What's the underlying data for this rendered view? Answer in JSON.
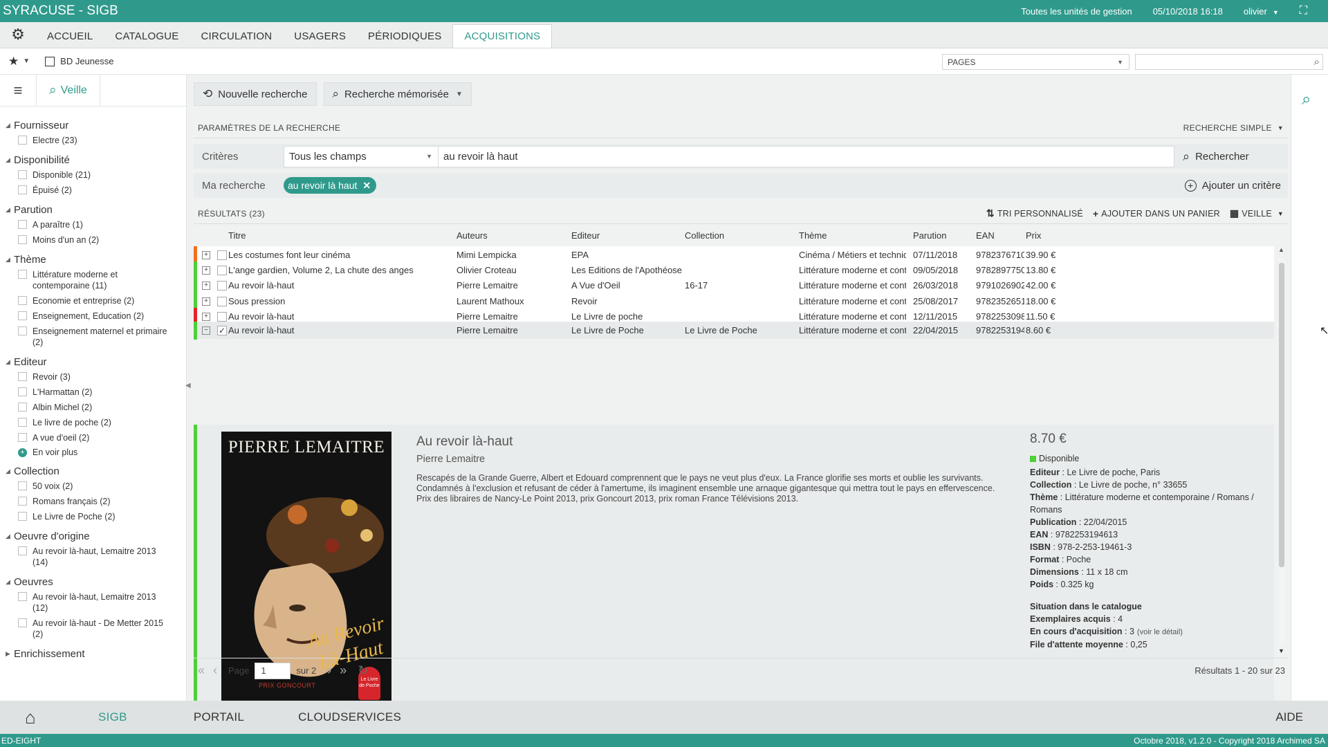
{
  "window": {
    "title": "SYRACUSE - SIGB",
    "units": "Toutes les unités de gestion",
    "datetime": "05/10/2018 16:18",
    "user": "olivier"
  },
  "menu": {
    "tabs": [
      "ACCUEIL",
      "CATALOGUE",
      "CIRCULATION",
      "USAGERS",
      "PÉRIODIQUES",
      "ACQUISITIONS"
    ],
    "active": "ACQUISITIONS"
  },
  "toolbar": {
    "bookmark": "BD Jeunesse",
    "pages_select": "PAGES",
    "search_value": ""
  },
  "sidebar": {
    "tab_label": "Veille",
    "facets": [
      {
        "title": "Fournisseur",
        "items": [
          "Electre (23)"
        ]
      },
      {
        "title": "Disponibilité",
        "items": [
          "Disponible (21)",
          "Épuisé (2)"
        ]
      },
      {
        "title": "Parution",
        "items": [
          "A paraître (1)",
          "Moins d'un an (2)"
        ]
      },
      {
        "title": "Thème",
        "items": [
          "Littérature moderne et contemporaine (11)",
          "Economie et entreprise (2)",
          "Enseignement, Education (2)",
          "Enseignement maternel et primaire (2)"
        ]
      },
      {
        "title": "Editeur",
        "items": [
          "Revoir (3)",
          "L'Harmattan (2)",
          "Albin Michel (2)",
          "Le livre de poche (2)",
          "A vue d'oeil (2)"
        ],
        "more": "En voir plus"
      },
      {
        "title": "Collection",
        "items": [
          "50 voix (2)",
          "Romans français (2)",
          "Le Livre de Poche (2)"
        ]
      },
      {
        "title": "Oeuvre d'origine",
        "items": [
          "Au revoir là-haut, Lemaitre 2013 (14)"
        ]
      },
      {
        "title": "Oeuvres",
        "items": [
          "Au revoir là-haut, Lemaitre 2013 (12)",
          "Au revoir là-haut - De Metter 2015 (2)"
        ]
      },
      {
        "title": "Enrichissement",
        "items": [],
        "collapsed": true
      }
    ]
  },
  "main": {
    "new_search": "Nouvelle recherche",
    "saved_search": "Recherche mémorisée",
    "params_title": "PARAMÈTRES DE LA RECHERCHE",
    "search_mode": "RECHERCHE SIMPLE",
    "criteria_label": "Critères",
    "criteria_field": "Tous les champs",
    "criteria_value": "au revoir là haut",
    "search_button": "Rechercher",
    "my_search_label": "Ma recherche",
    "my_search_tag": "au revoir là haut",
    "add_criterion": "Ajouter un critère"
  },
  "results": {
    "title": "RÉSULTATS (23)",
    "sort": "TRI PERSONNALISÉ",
    "add_cart": "AJOUTER DANS UN PANIER",
    "veille": "VEILLE",
    "columns": [
      "Titre",
      "Auteurs",
      "Editeur",
      "Collection",
      "Thème",
      "Parution",
      "EAN",
      "Prix"
    ],
    "rows": [
      {
        "flag": "#f2711c",
        "cells": [
          "Les costumes font leur cinéma",
          "Mimi Lempicka",
          "EPA",
          "",
          "Cinéma / Métiers et techniqu...",
          "07/11/2018",
          "9782376710...",
          "39.90 €"
        ]
      },
      {
        "flag": "#4cd137",
        "cells": [
          "L'ange gardien, Volume 2, La chute des anges",
          "Olivier Croteau",
          "Les Editions de l'Apothéose",
          "",
          "Littérature moderne et conte...",
          "09/05/2018",
          "9782897750...",
          "13.80 €"
        ]
      },
      {
        "flag": "#4cd137",
        "cells": [
          "Au revoir là-haut",
          "Pierre Lemaitre",
          "A Vue d'Oeil",
          "16-17",
          "Littérature moderne et conte...",
          "26/03/2018",
          "9791026902...",
          "42.00 €"
        ]
      },
      {
        "flag": "#4cd137",
        "cells": [
          "Sous pression",
          "Laurent Mathoux",
          "Revoir",
          "",
          "Littérature moderne et conte...",
          "25/08/2017",
          "9782352651...",
          "18.00 €"
        ]
      },
      {
        "flag": "#e8242c",
        "cells": [
          "Au revoir là-haut",
          "Pierre Lemaitre",
          "Le Livre de poche",
          "",
          "Littérature moderne et conte...",
          "12/11/2015",
          "9782253098...",
          "11.50 €"
        ]
      },
      {
        "flag": "#4cd137",
        "selected": true,
        "cells": [
          "Au revoir là-haut",
          "Pierre Lemaitre",
          "Le Livre de Poche",
          "Le Livre de Poche",
          "Littérature moderne et conte...",
          "22/04/2015",
          "9782253194...",
          "8.60 €"
        ]
      }
    ],
    "detail": {
      "cover_author": "PIERRE LEMAITRE",
      "cover_title_1": "Au Revoir",
      "cover_title_2": "Là-Haut",
      "cover_prize": "PRIX GONCOURT",
      "cover_badge_1": "Le Livre",
      "cover_badge_2": "de Poche",
      "title": "Au revoir là-haut",
      "author": "Pierre Lemaitre",
      "description": "Rescapés de la Grande Guerre, Albert et Edouard comprennent que le pays ne veut plus d'eux. La France glorifie ses morts et oublie les survivants. Condamnés à l'exclusion et refusant de céder à l'amertume, ils imaginent ensemble une arnaque gigantesque qui mettra tout le pays en effervescence. Prix des libraires de Nancy-Le Point 2013, prix Goncourt 2013, prix roman France Télévisions 2013.",
      "price": "8.70 €",
      "availability": "Disponible",
      "info": [
        {
          "k": "Editeur",
          "v": "Le Livre de poche, Paris"
        },
        {
          "k": "Collection",
          "v": "Le Livre de poche, n° 33655"
        },
        {
          "k": "Thème",
          "v": "Littérature moderne et contemporaine / Romans / Romans"
        },
        {
          "k": "Publication",
          "v": "22/04/2015"
        },
        {
          "k": "EAN",
          "v": "9782253194613"
        },
        {
          "k": "ISBN",
          "v": "978-2-253-19461-3"
        },
        {
          "k": "Format",
          "v": "Poche"
        },
        {
          "k": "Dimensions",
          "v": "11 x 18 cm"
        },
        {
          "k": "Poids",
          "v": "0.325 kg"
        }
      ],
      "catalog_title": "Situation dans le catalogue",
      "catalog": [
        {
          "k": "Exemplaires acquis",
          "v": "4",
          "extra": ""
        },
        {
          "k": "En cours d'acquisition",
          "v": "3",
          "extra": "(voir le détail)"
        },
        {
          "k": "File d'attente moyenne",
          "v": "0,25",
          "extra": ""
        }
      ]
    },
    "pager": {
      "page_label": "Page",
      "page_value": "1",
      "of_label": "sur 2",
      "count": "Résultats 1 - 20 sur 23"
    }
  },
  "bottomnav": {
    "items": [
      "SIGB",
      "PORTAIL",
      "CLOUDSERVICES"
    ],
    "active": "SIGB",
    "help": "AIDE"
  },
  "statusbar": {
    "left": "ED-EIGHT",
    "right": "Octobre 2018, v1.2.0 - Copyright 2018 Archimed SA"
  },
  "colors": {
    "accent": "#2f9a8c",
    "available": "#4cd137",
    "warning": "#f2711c",
    "danger": "#e8242c"
  }
}
